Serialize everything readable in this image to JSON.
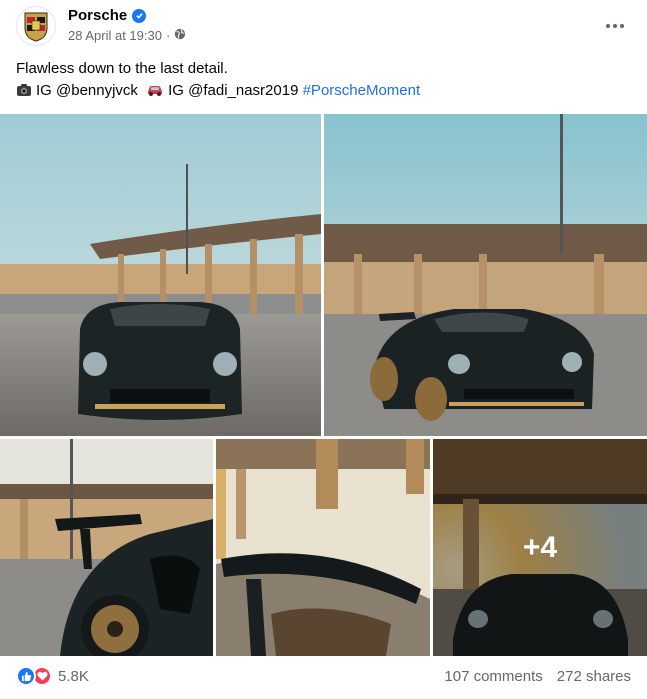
{
  "post": {
    "page_name": "Porsche",
    "timestamp": "28 April at 19:30",
    "separator": "·",
    "verified": true,
    "audience_icon": "globe-icon",
    "caption_line1": "Flawless down to the last detail.",
    "caption_credit1": "IG @bennyjvck",
    "caption_credit2": "IG @fadi_nasr2019",
    "hashtag": "#PorscheMoment"
  },
  "gallery": {
    "extra_count_label": "+4"
  },
  "footer": {
    "reaction_count": "5.8K",
    "comments": "107 comments",
    "shares": "272 shares"
  },
  "colors": {
    "link": "#216fdb",
    "like": "#1877f2",
    "love": "#f33e58",
    "secondary_text": "#65676b"
  }
}
